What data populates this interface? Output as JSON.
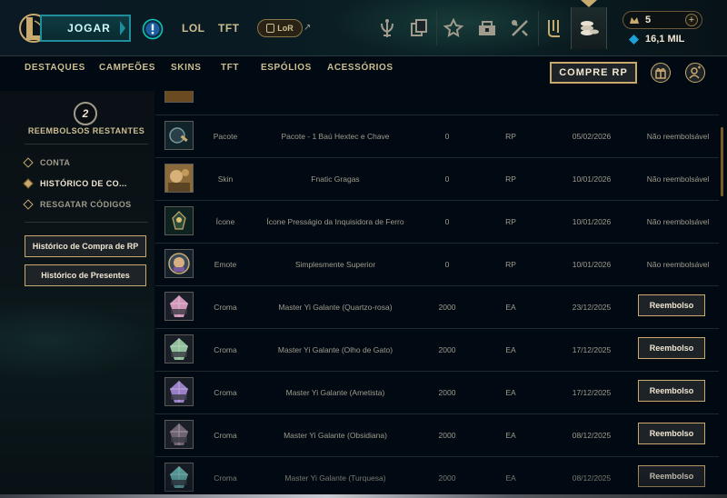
{
  "header": {
    "play_label": "JOGAR",
    "modes": [
      "LOL",
      "TFT"
    ],
    "lor_label": "LoR",
    "icons": [
      "profile-icon",
      "collection-icon",
      "crafting-icon",
      "loot-icon",
      "tft-icon",
      "clash-icon",
      "store-icon"
    ],
    "wallet": {
      "rp": "5",
      "blue_essence": "16,1 MIL"
    }
  },
  "store_nav": {
    "items": [
      "DESTAQUES",
      "CAMPEÕES",
      "SKINS",
      "TFT",
      "ESPÓLIOS",
      "ACESSÓRIOS"
    ],
    "buy_rp_label": "COMPRE RP"
  },
  "sidebar": {
    "refunds_count": "2",
    "refunds_label": "REEMBOLSOS RESTANTES",
    "items": [
      {
        "label": "CONTA",
        "active": false
      },
      {
        "label": "HISTÓRICO DE CO...",
        "active": true
      },
      {
        "label": "RESGATAR CÓDIGOS",
        "active": false
      }
    ],
    "buttons": [
      "Histórico de Compra de RP",
      "Histórico de Presentes"
    ]
  },
  "purchases": [
    {
      "icon": "hextec-chest-icon",
      "type": "Pacote",
      "name": "Pacote - 1 Baú Hextec e Chave",
      "cost": "0",
      "currency": "RP",
      "date": "05/02/2026",
      "status": "Não reembolsável",
      "refundable": false
    },
    {
      "icon": "gragas-skin-icon",
      "type": "Skin",
      "name": "Fnatic Gragas",
      "cost": "0",
      "currency": "RP",
      "date": "10/01/2026",
      "status": "Não reembolsável",
      "refundable": false
    },
    {
      "icon": "summoner-icon",
      "type": "Ícone",
      "name": "Ícone Presságio da Inquisidora de Ferro",
      "cost": "0",
      "currency": "RP",
      "date": "10/01/2026",
      "status": "Não reembolsável",
      "refundable": false
    },
    {
      "icon": "emote-icon",
      "type": "Emote",
      "name": "Simplesmente Superior",
      "cost": "0",
      "currency": "RP",
      "date": "10/01/2026",
      "status": "Não reembolsável",
      "refundable": false
    },
    {
      "icon": "chroma-icon",
      "type": "Croma",
      "name": "Master Yi Galante (Quartzo-rosa)",
      "cost": "2000",
      "currency": "EA",
      "date": "23/12/2025",
      "status": "Reembolso",
      "refundable": true
    },
    {
      "icon": "chroma-icon",
      "type": "Croma",
      "name": "Master Yi Galante (Olho de Gato)",
      "cost": "2000",
      "currency": "EA",
      "date": "17/12/2025",
      "status": "Reembolso",
      "refundable": true
    },
    {
      "icon": "chroma-icon",
      "type": "Croma",
      "name": "Master Yi Galante (Ametista)",
      "cost": "2000",
      "currency": "EA",
      "date": "17/12/2025",
      "status": "Reembolso",
      "refundable": true
    },
    {
      "icon": "chroma-icon",
      "type": "Croma",
      "name": "Master Yi Galante (Obsidiana)",
      "cost": "2000",
      "currency": "EA",
      "date": "08/12/2025",
      "status": "Reembolso",
      "refundable": true
    },
    {
      "icon": "chroma-icon",
      "type": "Croma",
      "name": "Master Yi Galante (Turquesa)",
      "cost": "2000",
      "currency": "EA",
      "date": "08/12/2025",
      "status": "Reembolso",
      "refundable": true
    }
  ],
  "colors": {
    "gold": "#c8aa6e",
    "teal": "#1e8e9a",
    "background": "#010a13",
    "chroma_tints": [
      "#e3a3c8",
      "#9fd0a8",
      "#a98ad8",
      "#7a6a7a",
      "#6fc2c0"
    ]
  }
}
